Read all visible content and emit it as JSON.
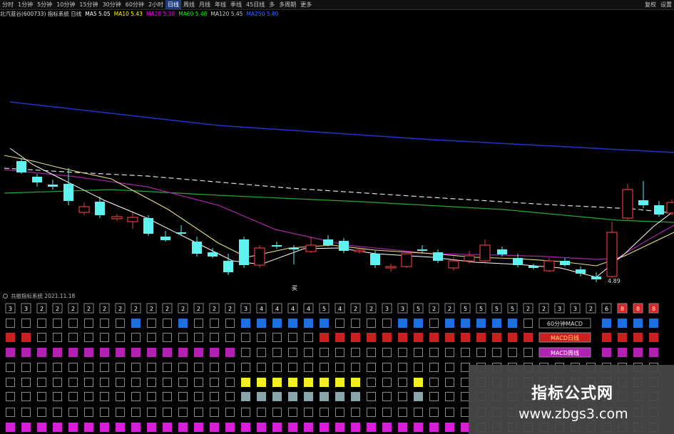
{
  "tabbar": {
    "tabs": [
      "分时",
      "1分钟",
      "5分钟",
      "10分钟",
      "15分钟",
      "30分钟",
      "60分钟",
      "2小时",
      "日线",
      "周线",
      "月线",
      "年线",
      "季线",
      "45日线",
      "多",
      "多周期",
      "更多"
    ],
    "active_index": 8,
    "right_items": [
      "复权",
      "设置"
    ]
  },
  "legend": {
    "title": "北汽蓝谷(600733) 指标系统 日线",
    "items": [
      {
        "label": "MA5 5.05",
        "color": "#ffffff"
      },
      {
        "label": "MA10 5.43",
        "color": "#ffff00"
      },
      {
        "label": "MA20 5.38",
        "color": "#ff00ff"
      },
      {
        "label": "MA60 5.48",
        "color": "#00ff00"
      },
      {
        "label": "MA120 5.45",
        "color": "#cccccc"
      },
      {
        "label": "MA250 5.80",
        "color": "#3b6bff"
      }
    ]
  },
  "chart": {
    "low_label": "4.89",
    "buy_marker": "买"
  },
  "sub_header": "共振指标系统 2021.11.18",
  "grid_labels": {
    "row_60min": "60分钟MACD",
    "row_macd_day": "MACD日线",
    "row_macd_week": "MACD周线"
  },
  "numbers_row": [
    3,
    3,
    2,
    2,
    2,
    2,
    2,
    2,
    2,
    2,
    2,
    2,
    2,
    2,
    2,
    3,
    4,
    4,
    4,
    4,
    5,
    4,
    2,
    2,
    3,
    3,
    5,
    2,
    2,
    5,
    5,
    5,
    5,
    2,
    2,
    3,
    3,
    2,
    6,
    8,
    8,
    8
  ],
  "watermark": {
    "title": "指标公式网",
    "url": "www.zbgs3.com"
  }
}
